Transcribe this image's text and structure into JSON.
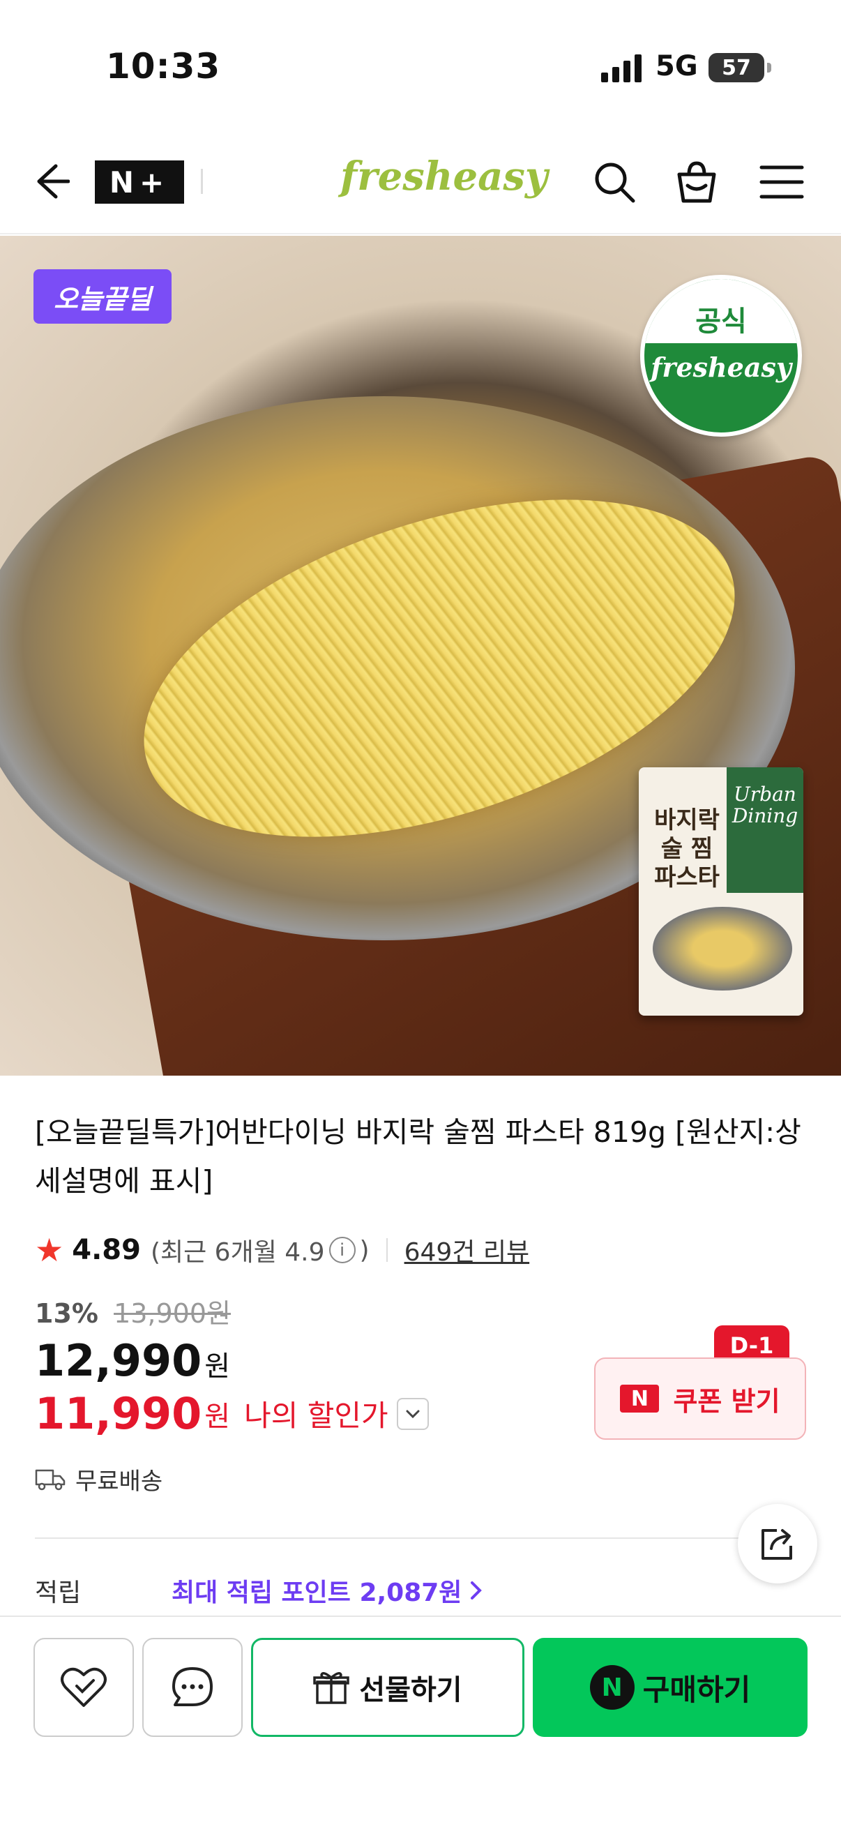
{
  "status": {
    "time": "10:33",
    "network": "5G",
    "battery": "57"
  },
  "header": {
    "logo_fresh": "fresh",
    "logo_easy": "easy",
    "nplus": "N+"
  },
  "hero": {
    "deal_badge": "오늘끝딜",
    "official_top": "공식",
    "official_bottom": "fresheasy",
    "pack_title": "바지락\n술 찜\n파스타",
    "pack_brand": "Urban\nDining"
  },
  "product": {
    "title": "[오늘끝딜특가]어반다이닝 바지락 술찜 파스타 819g [원산지:상세설명에 표시]",
    "rating": "4.89",
    "recent_rating": "(최근 6개월 4.9",
    "recent_rating_close": ")",
    "reviews": "649건 리뷰",
    "discount_pct": "13%",
    "original_price": "13,900원",
    "price": "12,990",
    "price_unit": "원",
    "my_price": "11,990",
    "my_price_unit": "원",
    "my_price_label": "나의 할인가",
    "coupon_label": "쿠폰 받기",
    "coupon_icon": "N",
    "dday": "D-1",
    "shipping": "무료배송",
    "points_label": "적립",
    "points_value": "최대 적립 포인트 2,087원"
  },
  "bottom": {
    "gift": "선물하기",
    "buy": "구매하기",
    "buy_icon": "N"
  },
  "colors": {
    "brand_green": "#03c75a",
    "sale_red": "#e4172c",
    "purple": "#6d3cf2",
    "deal_purple": "#7b4df6"
  }
}
